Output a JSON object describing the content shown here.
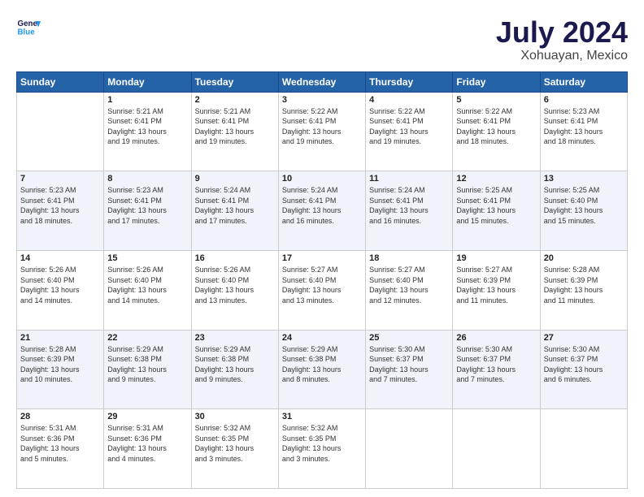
{
  "logo": {
    "line1": "General",
    "line2": "Blue"
  },
  "title": "July 2024",
  "subtitle": "Xohuayan, Mexico",
  "header_days": [
    "Sunday",
    "Monday",
    "Tuesday",
    "Wednesday",
    "Thursday",
    "Friday",
    "Saturday"
  ],
  "weeks": [
    [
      {
        "num": "",
        "info": ""
      },
      {
        "num": "1",
        "info": "Sunrise: 5:21 AM\nSunset: 6:41 PM\nDaylight: 13 hours\nand 19 minutes."
      },
      {
        "num": "2",
        "info": "Sunrise: 5:21 AM\nSunset: 6:41 PM\nDaylight: 13 hours\nand 19 minutes."
      },
      {
        "num": "3",
        "info": "Sunrise: 5:22 AM\nSunset: 6:41 PM\nDaylight: 13 hours\nand 19 minutes."
      },
      {
        "num": "4",
        "info": "Sunrise: 5:22 AM\nSunset: 6:41 PM\nDaylight: 13 hours\nand 19 minutes."
      },
      {
        "num": "5",
        "info": "Sunrise: 5:22 AM\nSunset: 6:41 PM\nDaylight: 13 hours\nand 18 minutes."
      },
      {
        "num": "6",
        "info": "Sunrise: 5:23 AM\nSunset: 6:41 PM\nDaylight: 13 hours\nand 18 minutes."
      }
    ],
    [
      {
        "num": "7",
        "info": "Sunrise: 5:23 AM\nSunset: 6:41 PM\nDaylight: 13 hours\nand 18 minutes."
      },
      {
        "num": "8",
        "info": "Sunrise: 5:23 AM\nSunset: 6:41 PM\nDaylight: 13 hours\nand 17 minutes."
      },
      {
        "num": "9",
        "info": "Sunrise: 5:24 AM\nSunset: 6:41 PM\nDaylight: 13 hours\nand 17 minutes."
      },
      {
        "num": "10",
        "info": "Sunrise: 5:24 AM\nSunset: 6:41 PM\nDaylight: 13 hours\nand 16 minutes."
      },
      {
        "num": "11",
        "info": "Sunrise: 5:24 AM\nSunset: 6:41 PM\nDaylight: 13 hours\nand 16 minutes."
      },
      {
        "num": "12",
        "info": "Sunrise: 5:25 AM\nSunset: 6:41 PM\nDaylight: 13 hours\nand 15 minutes."
      },
      {
        "num": "13",
        "info": "Sunrise: 5:25 AM\nSunset: 6:40 PM\nDaylight: 13 hours\nand 15 minutes."
      }
    ],
    [
      {
        "num": "14",
        "info": "Sunrise: 5:26 AM\nSunset: 6:40 PM\nDaylight: 13 hours\nand 14 minutes."
      },
      {
        "num": "15",
        "info": "Sunrise: 5:26 AM\nSunset: 6:40 PM\nDaylight: 13 hours\nand 14 minutes."
      },
      {
        "num": "16",
        "info": "Sunrise: 5:26 AM\nSunset: 6:40 PM\nDaylight: 13 hours\nand 13 minutes."
      },
      {
        "num": "17",
        "info": "Sunrise: 5:27 AM\nSunset: 6:40 PM\nDaylight: 13 hours\nand 13 minutes."
      },
      {
        "num": "18",
        "info": "Sunrise: 5:27 AM\nSunset: 6:40 PM\nDaylight: 13 hours\nand 12 minutes."
      },
      {
        "num": "19",
        "info": "Sunrise: 5:27 AM\nSunset: 6:39 PM\nDaylight: 13 hours\nand 11 minutes."
      },
      {
        "num": "20",
        "info": "Sunrise: 5:28 AM\nSunset: 6:39 PM\nDaylight: 13 hours\nand 11 minutes."
      }
    ],
    [
      {
        "num": "21",
        "info": "Sunrise: 5:28 AM\nSunset: 6:39 PM\nDaylight: 13 hours\nand 10 minutes."
      },
      {
        "num": "22",
        "info": "Sunrise: 5:29 AM\nSunset: 6:38 PM\nDaylight: 13 hours\nand 9 minutes."
      },
      {
        "num": "23",
        "info": "Sunrise: 5:29 AM\nSunset: 6:38 PM\nDaylight: 13 hours\nand 9 minutes."
      },
      {
        "num": "24",
        "info": "Sunrise: 5:29 AM\nSunset: 6:38 PM\nDaylight: 13 hours\nand 8 minutes."
      },
      {
        "num": "25",
        "info": "Sunrise: 5:30 AM\nSunset: 6:37 PM\nDaylight: 13 hours\nand 7 minutes."
      },
      {
        "num": "26",
        "info": "Sunrise: 5:30 AM\nSunset: 6:37 PM\nDaylight: 13 hours\nand 7 minutes."
      },
      {
        "num": "27",
        "info": "Sunrise: 5:30 AM\nSunset: 6:37 PM\nDaylight: 13 hours\nand 6 minutes."
      }
    ],
    [
      {
        "num": "28",
        "info": "Sunrise: 5:31 AM\nSunset: 6:36 PM\nDaylight: 13 hours\nand 5 minutes."
      },
      {
        "num": "29",
        "info": "Sunrise: 5:31 AM\nSunset: 6:36 PM\nDaylight: 13 hours\nand 4 minutes."
      },
      {
        "num": "30",
        "info": "Sunrise: 5:32 AM\nSunset: 6:35 PM\nDaylight: 13 hours\nand 3 minutes."
      },
      {
        "num": "31",
        "info": "Sunrise: 5:32 AM\nSunset: 6:35 PM\nDaylight: 13 hours\nand 3 minutes."
      },
      {
        "num": "",
        "info": ""
      },
      {
        "num": "",
        "info": ""
      },
      {
        "num": "",
        "info": ""
      }
    ]
  ]
}
